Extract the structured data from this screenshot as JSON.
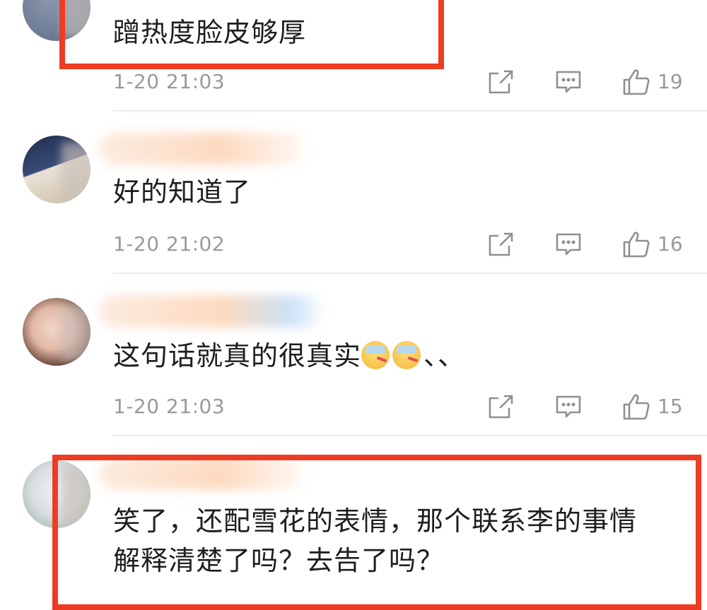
{
  "comments": [
    {
      "text": "蹭热度脸皮够厚",
      "time": "1-20 21:03",
      "likes": "19",
      "avatar_colors": [
        "#5b6b86",
        "#c9b9a8"
      ]
    },
    {
      "text": "好的知道了",
      "time": "1-20 21:02",
      "likes": "16",
      "avatar_colors": [
        "#2d3a5a",
        "#d8c6b0"
      ]
    },
    {
      "text": "这句话就真的很真实",
      "text_suffix": "、、",
      "emoji": "cold-sweat-thermometer-face",
      "time": "1-20 21:03",
      "likes": "15",
      "avatar_colors": [
        "#e8c4b6",
        "#5a3a2e"
      ]
    },
    {
      "text_line1": "笑了，还配雪花的表情，那个联系李的事情",
      "text_line2": "解释清楚了吗？去告了吗？",
      "avatar_colors": [
        "#dfe2e6",
        "#9fb8a8"
      ]
    }
  ],
  "colors": {
    "highlight": "#ee3b24",
    "meta_text": "#9a9a9a",
    "divider": "#ebebeb"
  },
  "icons": [
    "share-icon",
    "reply-icon",
    "like-icon"
  ]
}
